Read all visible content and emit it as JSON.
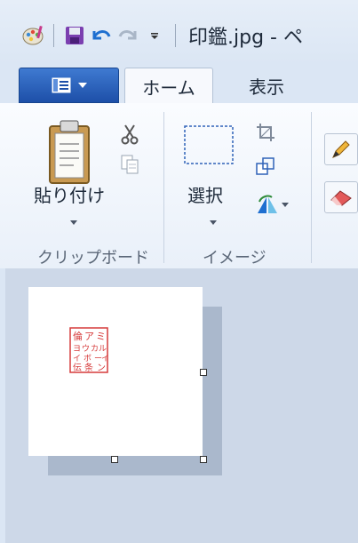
{
  "window": {
    "title": "印鑑.jpg - ペ"
  },
  "tabs": [
    {
      "label": "ホーム",
      "active": true
    },
    {
      "label": "表示",
      "active": false
    }
  ],
  "ribbon": {
    "clipboard": {
      "paste_label": "貼り付け",
      "group_label": "クリップボード"
    },
    "image": {
      "select_label": "選択",
      "group_label": "イメージ"
    }
  },
  "canvas": {
    "stamp_text": [
      "倫",
      "ア",
      "ミ",
      "ヨ",
      "ウ",
      "カ",
      "ル",
      "イ",
      "ボ",
      "ー",
      "イ",
      "伝",
      "条",
      "ン"
    ]
  },
  "colors": {
    "file_button": "#1d4fa8",
    "stamp_red": "#d63b3b",
    "ribbon_bg": "#f7f9fd",
    "workspace_bg": "#cdd8e8"
  }
}
